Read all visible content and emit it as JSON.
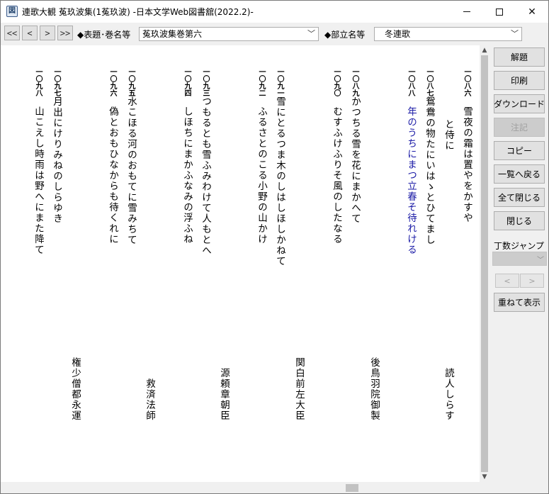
{
  "window": {
    "title": "連歌大観 菟玖波集(1菟玖波) -日本文学Web図書舘(2022.2)-",
    "icon": "book-app-icon"
  },
  "toolbar": {
    "first_label": "<<",
    "prev_label": "<",
    "next_label": ">",
    "last_label": ">>",
    "title_label": "◆表題･巻名等",
    "title_value": "菟玖波集巻第六",
    "section_label": "◆部立名等",
    "section_value": "冬連歌"
  },
  "verses": [
    {
      "num": "一〇八六",
      "text": "雪夜の霜は置やをかすや",
      "color": "#000000"
    },
    {
      "num": "",
      "text": "と侍に",
      "color": "#000000"
    },
    {
      "num": "一〇八七",
      "text": "鴛鴦の物たにいはゝとひてまし",
      "color": "#000000"
    },
    {
      "num": "一〇八八",
      "text": "年のうちにまつ立春そ待れける",
      "color": "#1a1aa6"
    },
    {
      "num": "一〇八九",
      "text": "かつちる雪を花にまかへて",
      "color": "#000000"
    },
    {
      "num": "一〇九〇",
      "text": "むすふけふりそ風のしたなる",
      "color": "#000000"
    },
    {
      "num": "一〇九一",
      "text": "雪にとるつま木のしはしほしかねて",
      "color": "#000000"
    },
    {
      "num": "一〇九二",
      "text": "ふるさとのこる小野の山かけ",
      "color": "#000000"
    },
    {
      "num": "一〇九三",
      "text": "つもるとも雪ふみわけて人もとへ",
      "color": "#000000"
    },
    {
      "num": "一〇九四",
      "text": "しほちにまかふなみの浮ふね",
      "color": "#000000"
    },
    {
      "num": "一〇九五",
      "text": "水こほる河のおもてに雪みちて",
      "color": "#000000"
    },
    {
      "num": "一〇九六",
      "text": "偽とおもひなからも待くれに",
      "color": "#000000"
    },
    {
      "num": "一〇九七",
      "text": "月出にけりみねのしらゆき",
      "color": "#000000"
    },
    {
      "num": "一〇九八",
      "text": "山こえし時雨は野へにまた降て",
      "color": "#000000"
    }
  ],
  "authors": [
    "読人しらす",
    "後鳥羽院御製",
    "関白前左大臣",
    "源頼章朝臣",
    "救済法師",
    "権少僧都永運"
  ],
  "side": {
    "kaidai": "解題",
    "print": "印刷",
    "download": "ダウンロード",
    "note": "注記",
    "copy": "コピー",
    "back_to_list": "一覧へ戻る",
    "close_all": "全て閉じる",
    "close": "閉じる",
    "jump_label": "丁数ジャンプ",
    "prev_label": "<",
    "next_label": ">",
    "overlay": "重ねて表示"
  }
}
